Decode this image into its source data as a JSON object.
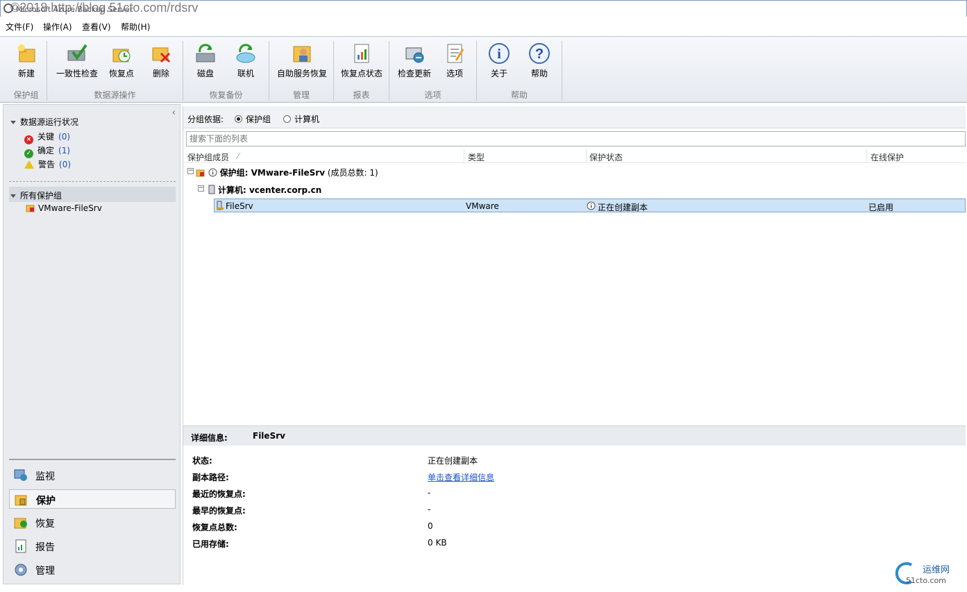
{
  "window": {
    "title": "Microsoft Azure Backup Server",
    "watermark": "©2018 http://blog.51cto.com/rdsrv"
  },
  "menu": [
    "文件(F)",
    "操作(A)",
    "查看(V)",
    "帮助(H)"
  ],
  "ribbon": {
    "groups": [
      {
        "label": "保护组",
        "buttons": [
          "新建"
        ]
      },
      {
        "label": "数据源操作",
        "buttons": [
          "一致性检查",
          "恢复点",
          "删除"
        ]
      },
      {
        "label": "恢复备份",
        "buttons": [
          "磁盘",
          "联机"
        ]
      },
      {
        "label": "管理",
        "buttons": [
          "自助服务恢复"
        ]
      },
      {
        "label": "报表",
        "buttons": [
          "恢复点状态"
        ]
      },
      {
        "label": "选项",
        "buttons": [
          "检查更新",
          "选项"
        ]
      },
      {
        "label": "帮助",
        "buttons": [
          "关于",
          "帮助"
        ]
      }
    ]
  },
  "left": {
    "health_title": "数据源运行状况",
    "health_items": [
      {
        "label": "关键",
        "count": "(0)",
        "icon": "critical-icon",
        "color": "#d8262b"
      },
      {
        "label": "确定",
        "count": "(1)",
        "icon": "ok-icon",
        "color": "#2e9a2e"
      },
      {
        "label": "警告",
        "count": "(0)",
        "icon": "warning-icon",
        "color": "#e8c020"
      }
    ],
    "all_groups_title": "所有保护组",
    "groups": [
      "VMware-FileSrv"
    ],
    "nav": [
      {
        "label": "监视",
        "icon": "monitor-icon"
      },
      {
        "label": "保护",
        "icon": "protection-icon",
        "active": true
      },
      {
        "label": "恢复",
        "icon": "recovery-icon"
      },
      {
        "label": "报告",
        "icon": "report-icon"
      },
      {
        "label": "管理",
        "icon": "management-icon"
      }
    ]
  },
  "main": {
    "group_by_label": "分组依据:",
    "group_by_options": [
      "保护组",
      "计算机"
    ],
    "search_placeholder": "搜索下面的列表",
    "columns": [
      "保护组成员",
      "类型",
      "保护状态",
      "在线保护"
    ],
    "group_row": {
      "prefix": "保护组: ",
      "name": "VMware-FileSrv",
      "suffix": " (成员总数: 1)"
    },
    "computer_row": {
      "prefix": "计算机: ",
      "name": "vcenter.corp.cn"
    },
    "member_row": {
      "name": "FileSrv",
      "type": "VMware",
      "status": "正在创建副本",
      "online": "已启用"
    }
  },
  "details": {
    "title_label": "详细信息:",
    "title_value": "FileSrv",
    "rows": [
      {
        "label": "状态:",
        "value": "正在创建副本"
      },
      {
        "label": "副本路径:",
        "value": "单击查看详细信息",
        "link": true
      },
      {
        "label": "最近的恢复点:",
        "value": "-"
      },
      {
        "label": "最早的恢复点:",
        "value": "-"
      },
      {
        "label": "恢复点总数:",
        "value": "0"
      },
      {
        "label": "已用存储:",
        "value": "0 KB"
      }
    ]
  },
  "logo": {
    "line1": "运维网",
    "line2": "51cto.com"
  }
}
